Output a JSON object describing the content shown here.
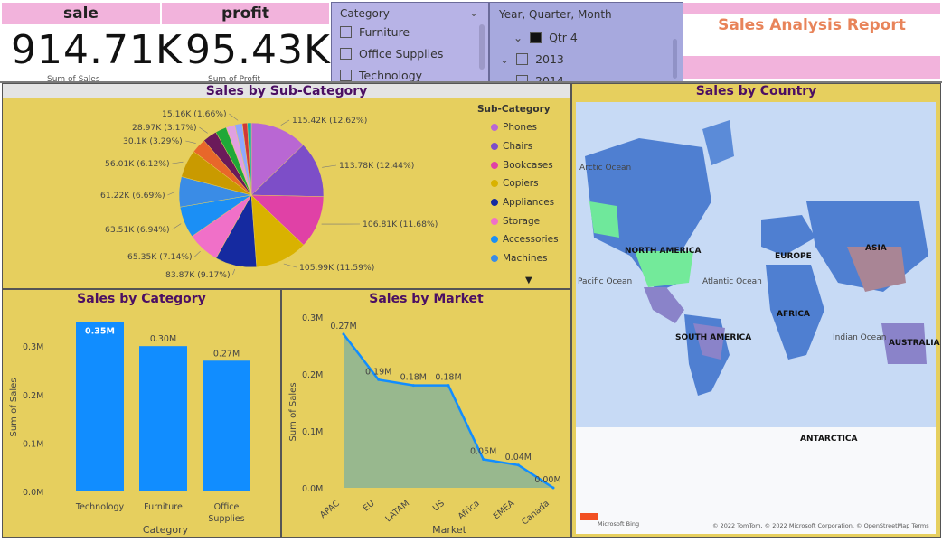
{
  "kpis": [
    {
      "title": "sale",
      "value": "914.71K",
      "sub": "Sum of Sales"
    },
    {
      "title": "profit",
      "value": "95.43K",
      "sub": "Sum of Profit"
    }
  ],
  "category_slicer": {
    "title": "Category",
    "items": [
      "Furniture",
      "Office Supplies",
      "Technology"
    ]
  },
  "date_slicer": {
    "title": "Year, Quarter, Month",
    "items": [
      {
        "label": "Qtr 4",
        "checked": true
      },
      {
        "label": "2013",
        "checked": false
      },
      {
        "label": "2014",
        "checked": false
      }
    ]
  },
  "report_title": "Sales Analysis Report",
  "colors": {
    "panel": "#e6cf5e",
    "panel_title": "#4b0f63",
    "bar": "#118dff",
    "pink_bar": "#f2b3dc",
    "report_title": "#e8845a",
    "slicer": "#b7b3e6"
  },
  "panels": {
    "subcategory_title": "Sales by Sub-Category",
    "category_title": "Sales by Category",
    "market_title": "Sales by Market",
    "country_title": "Sales by Country"
  },
  "map": {
    "labels": [
      "Arctic Ocean",
      "NORTH AMERICA",
      "Atlantic Ocean",
      "Pacific Ocean",
      "EUROPE",
      "ASIA",
      "AFRICA",
      "SOUTH AMERICA",
      "Indian Ocean",
      "AUSTRALIA",
      "ANTARCTICA"
    ],
    "attribution": "© 2022 TomTom, © 2022 Microsoft Corporation, © OpenStreetMap  Terms",
    "bing": "Microsoft Bing"
  },
  "chart_data": [
    {
      "type": "pie",
      "title": "Sales by Sub-Category",
      "legend_title": "Sub-Category",
      "legend_placement": "right",
      "legend": [
        "Phones",
        "Chairs",
        "Bookcases",
        "Copiers",
        "Appliances",
        "Storage",
        "Accessories",
        "Machines"
      ],
      "slices": [
        {
          "value": 115.42,
          "label": "115.42K (12.62%)",
          "color": "#b967d3"
        },
        {
          "value": 113.78,
          "label": "113.78K (12.44%)",
          "color": "#7d4ec8"
        },
        {
          "value": 106.81,
          "label": "106.81K (11.68%)",
          "color": "#e041a6"
        },
        {
          "value": 105.99,
          "label": "105.99K (11.59%)",
          "color": "#d9b200"
        },
        {
          "value": 83.87,
          "label": "83.87K (9.17%)",
          "color": "#152aa0"
        },
        {
          "value": 65.35,
          "label": "65.35K (7.14%)",
          "color": "#f070c8"
        },
        {
          "value": 63.51,
          "label": "63.51K (6.94%)",
          "color": "#1b8ff5"
        },
        {
          "value": 61.22,
          "label": "61.22K (6.69%)",
          "color": "#3a8ce6"
        },
        {
          "value": 56.01,
          "label": "56.01K (6.12%)",
          "color": "#c99a00"
        },
        {
          "value": 30.1,
          "label": "30.1K (3.29%)",
          "color": "#e8672a"
        },
        {
          "value": 28.97,
          "label": "28.97K (3.17%)",
          "color": "#6b1a5a"
        },
        {
          "value": 22.5,
          "label": "",
          "color": "#1fa838"
        },
        {
          "value": 18.2,
          "label": "",
          "color": "#e0a0e0"
        },
        {
          "value": 15.16,
          "label": "15.16K (1.66%)",
          "color": "#8fa8ff"
        },
        {
          "value": 10.0,
          "label": "",
          "color": "#d03838"
        },
        {
          "value": 8.0,
          "label": "",
          "color": "#10b0b0"
        }
      ]
    },
    {
      "type": "bar",
      "title": "Sales by Category",
      "categories": [
        "Technology",
        "Furniture",
        "Office Supplies"
      ],
      "values": [
        0.35,
        0.3,
        0.27
      ],
      "data_labels": [
        "0.35M",
        "0.30M",
        "0.27M"
      ],
      "xlabel": "Category",
      "ylabel": "Sum of Sales",
      "ylim": [
        0,
        0.36
      ],
      "yticks": [
        "0.0M",
        "0.1M",
        "0.2M",
        "0.3M"
      ]
    },
    {
      "type": "area",
      "title": "Sales by Market",
      "categories": [
        "APAC",
        "EU",
        "LATAM",
        "US",
        "Africa",
        "EMEA",
        "Canada"
      ],
      "values": [
        0.27,
        0.19,
        0.18,
        0.18,
        0.05,
        0.04,
        0.0
      ],
      "data_labels": [
        "0.27M",
        "0.19M",
        "0.18M",
        "0.18M",
        "0.05M",
        "0.04M",
        "0.00M"
      ],
      "xlabel": "Market",
      "ylabel": "Sum of Sales",
      "ylim": [
        0,
        0.3
      ],
      "yticks": [
        "0.0M",
        "0.1M",
        "0.2M",
        "0.3M"
      ]
    }
  ]
}
